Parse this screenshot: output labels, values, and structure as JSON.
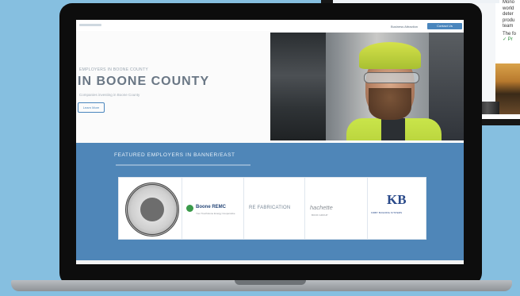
{
  "background_device": {
    "text_lines": [
      "Mono",
      "world",
      "deter",
      "produ",
      "team",
      "The fo",
      "✓ Pr"
    ]
  },
  "website": {
    "nav": {
      "link": "Business Attraction",
      "cta": "Contact Us"
    },
    "hero": {
      "kicker": "EMPLOYERS IN BOONE COUNTY",
      "title": "IN BOONE COUNTY",
      "subtitle": "Companies investing in Boone County",
      "button": "Learn More"
    },
    "featured": {
      "title": "FEATURED EMPLOYERS IN BANNER/EAST",
      "logos": [
        {
          "name": "county-seal",
          "label": ""
        },
        {
          "name": "boone-remc",
          "label": "Boone REMC",
          "sub": "Your Touchstone Energy Cooperative"
        },
        {
          "name": "re-fabrication",
          "label": "RE FABRICATION"
        },
        {
          "name": "hachette",
          "label": "hachette",
          "sub": "BOOK GROUP"
        },
        {
          "name": "kb",
          "label": "KB",
          "sub": "KIRBY BUILDING SYSTEMS"
        }
      ]
    }
  },
  "colors": {
    "page_bg": "#86bfe0",
    "band": "#4f86b8",
    "accent": "#4a86bd",
    "laptop": "#0d0d0d"
  }
}
